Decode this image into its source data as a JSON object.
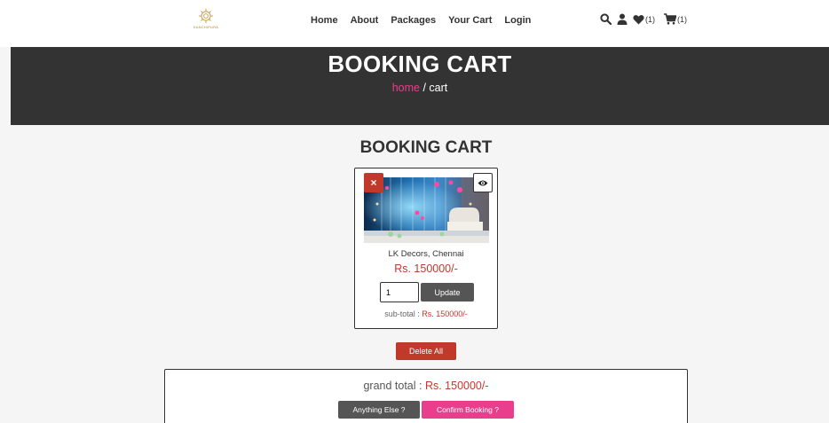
{
  "logo": {
    "text": "KANCHIPURA"
  },
  "nav": {
    "home": "Home",
    "about": "About",
    "packages": "Packages",
    "cart": "Your Cart",
    "login": "Login"
  },
  "header_icons": {
    "wishlist_count": "(1)",
    "cart_count": "(1)",
    "icons": [
      "search-icon",
      "user-icon",
      "heart-icon",
      "cart-icon"
    ]
  },
  "hero": {
    "title": "BOOKING CART",
    "crumb_home": "home",
    "crumb_sep": " / cart"
  },
  "section_title": "BOOKING CART",
  "cart_item": {
    "name": "LK Decors, Chennai",
    "price": "Rs. 150000/-",
    "quantity": "1",
    "update_label": "Update",
    "subtotal_label": "sub-total : ",
    "subtotal_value": "Rs. 150000/-",
    "remove_glyph": "×"
  },
  "delete_all_label": "Delete All",
  "totals": {
    "grand_label": "grand total : ",
    "grand_value": "Rs. 150000/-",
    "anything_else_label": "Anything Else ?",
    "confirm_label": "Confirm Booking ?"
  },
  "colors": {
    "accent_pink": "#e83e8c",
    "danger_red": "#c0392b",
    "dark_band": "#333333",
    "button_gray": "#555555"
  }
}
